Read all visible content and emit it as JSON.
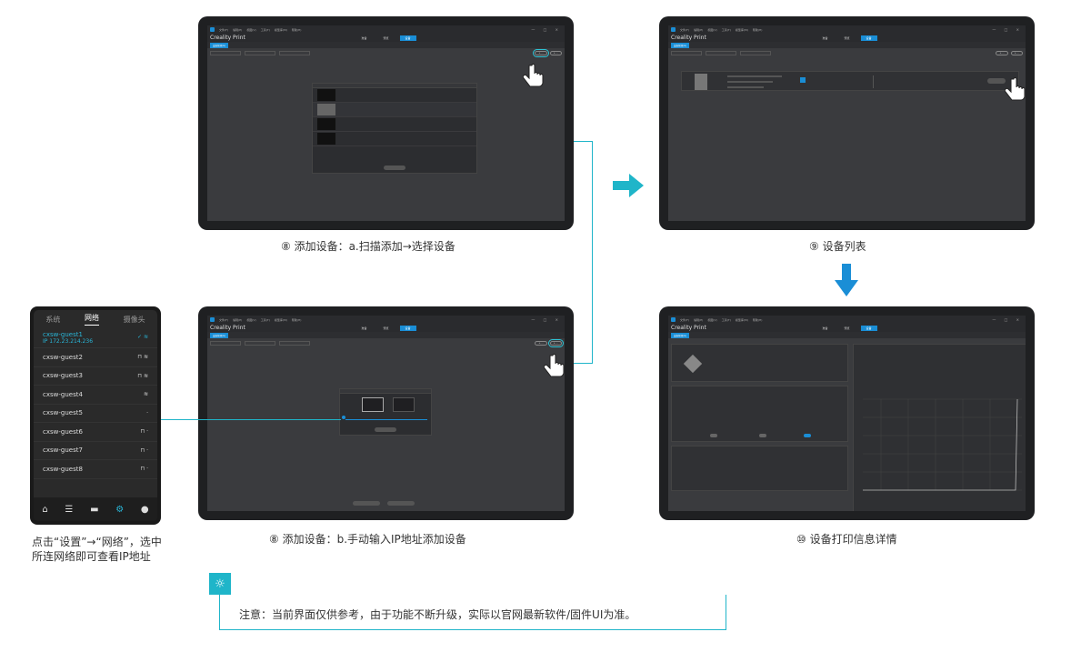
{
  "app": {
    "menu": [
      "文件(F)",
      "编辑(E)",
      "视图(V)",
      "工具(T)",
      "模型库(M)",
      "帮助(H)"
    ],
    "title": "Creality Print",
    "tabs": [
      "准备",
      "预览",
      "设备"
    ],
    "sub_chip": "设备管理(G)"
  },
  "captions": {
    "c1": "⑧ 添加设备：a.扫描添加→选择设备",
    "c2": "⑨ 设备列表",
    "c3": "⑧ 添加设备：b.手动输入IP地址添加设备",
    "c4": "⑩ 设备打印信息详情"
  },
  "phone": {
    "tabs": [
      "系统",
      "网络",
      "摄像头"
    ],
    "active_tab": "网络",
    "selected": {
      "name": "cxsw-guest1",
      "ip": "IP  172.23.214.236"
    },
    "networks": [
      "cxsw-guest2",
      "cxsw-guest3",
      "cxsw-guest4",
      "cxsw-guest5",
      "cxsw-guest6",
      "cxsw-guest7",
      "cxsw-guest8"
    ],
    "caption": "点击“设置”→“网络”，选中所连网络即可查看IP地址"
  },
  "note": {
    "text": "注意：当前界面仅供参考，由于功能不断升级，实际以官网最新软件/固件UI为准。"
  },
  "colors": {
    "accent": "#1a8ed6",
    "cyan": "#1fb5c9",
    "screen_bg": "#3a3b3e"
  },
  "icons": [
    "hand-pointer-icon",
    "arrow-right-icon",
    "arrow-down-icon",
    "lightbulb-icon",
    "wifi-icon",
    "lock-icon",
    "check-icon",
    "home-icon",
    "settings-icon"
  ]
}
